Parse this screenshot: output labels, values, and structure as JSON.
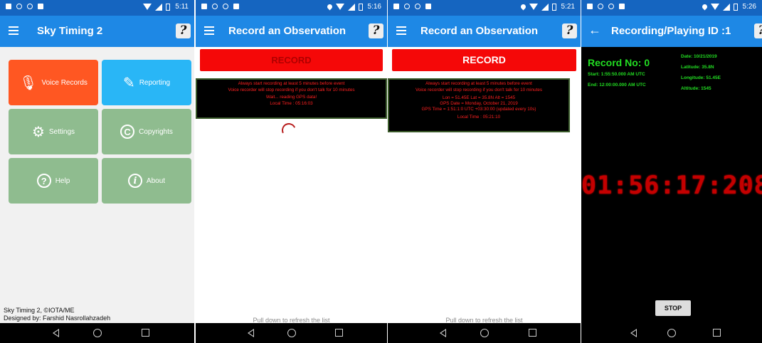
{
  "colors": {
    "statusbar": "#1565c0",
    "toolbar": "#1e88e5",
    "record": "#f50808",
    "voice_tile": "#ff5722",
    "report_tile": "#29b6f6",
    "grey_tile": "#8fbc8f",
    "led": "#c40000",
    "green_text": "#22dd22"
  },
  "screen1": {
    "status_time": "5:11",
    "title": "Sky Timing 2",
    "tiles": [
      {
        "label": "Voice Records",
        "icon": "microphone-icon"
      },
      {
        "label": "Reporting",
        "icon": "report-edit-icon"
      },
      {
        "label": "Settings",
        "icon": "gear-icon"
      },
      {
        "label": "Copyrights",
        "icon": "copyright-icon"
      },
      {
        "label": "Help",
        "icon": "question-icon"
      },
      {
        "label": "About",
        "icon": "info-icon"
      }
    ],
    "footer_line1": "Sky Timing 2, ©IOTA/ME",
    "footer_line2": "Designed by: Farshid Nasrollahzadeh"
  },
  "screen2": {
    "status_time": "5:16",
    "title": "Record an Observation",
    "record_label": "RECORD",
    "lines": [
      "Always start recording at least 5 minutes before event",
      "Voice recorder will stop recording if you don't talk for 10 minutes",
      "Wait... reading GPS data!",
      "Local Time : 05:16:03"
    ],
    "pull_text": "Pull down to refresh the list"
  },
  "screen3": {
    "status_time": "5:21",
    "title": "Record an Observation",
    "record_label": "RECORD",
    "lines": [
      "Always start recording at least 5 minutes before event",
      "Voice recorder will stop recording if you don't talk for 10 minutes",
      "Lon = 51.45E Lat = 35.8N Alt = 1545",
      "GPS Date = Monday, October 21, 2019",
      "GPS Time = 1:51:1:0 UTC +03:30:00 (updated every 10s)",
      "Local Time : 05:21:10"
    ],
    "pull_text": "Pull down to refresh the list"
  },
  "screen4": {
    "status_time": "5:26",
    "title": "Recording/Playing ID :1",
    "record_no": "Record No: 0",
    "start": "Start: 1:55:50.000 AM UTC",
    "end": "End: 12:00:00.000 AM UTC",
    "date": "Date: 10/21/2019",
    "latitude": "Latitude:  35.8N",
    "longitude": "Longitude: 51.45E",
    "altitude": "Altitude:  1545",
    "led_time": "01:56:17:208",
    "stop_label": "STOP"
  }
}
